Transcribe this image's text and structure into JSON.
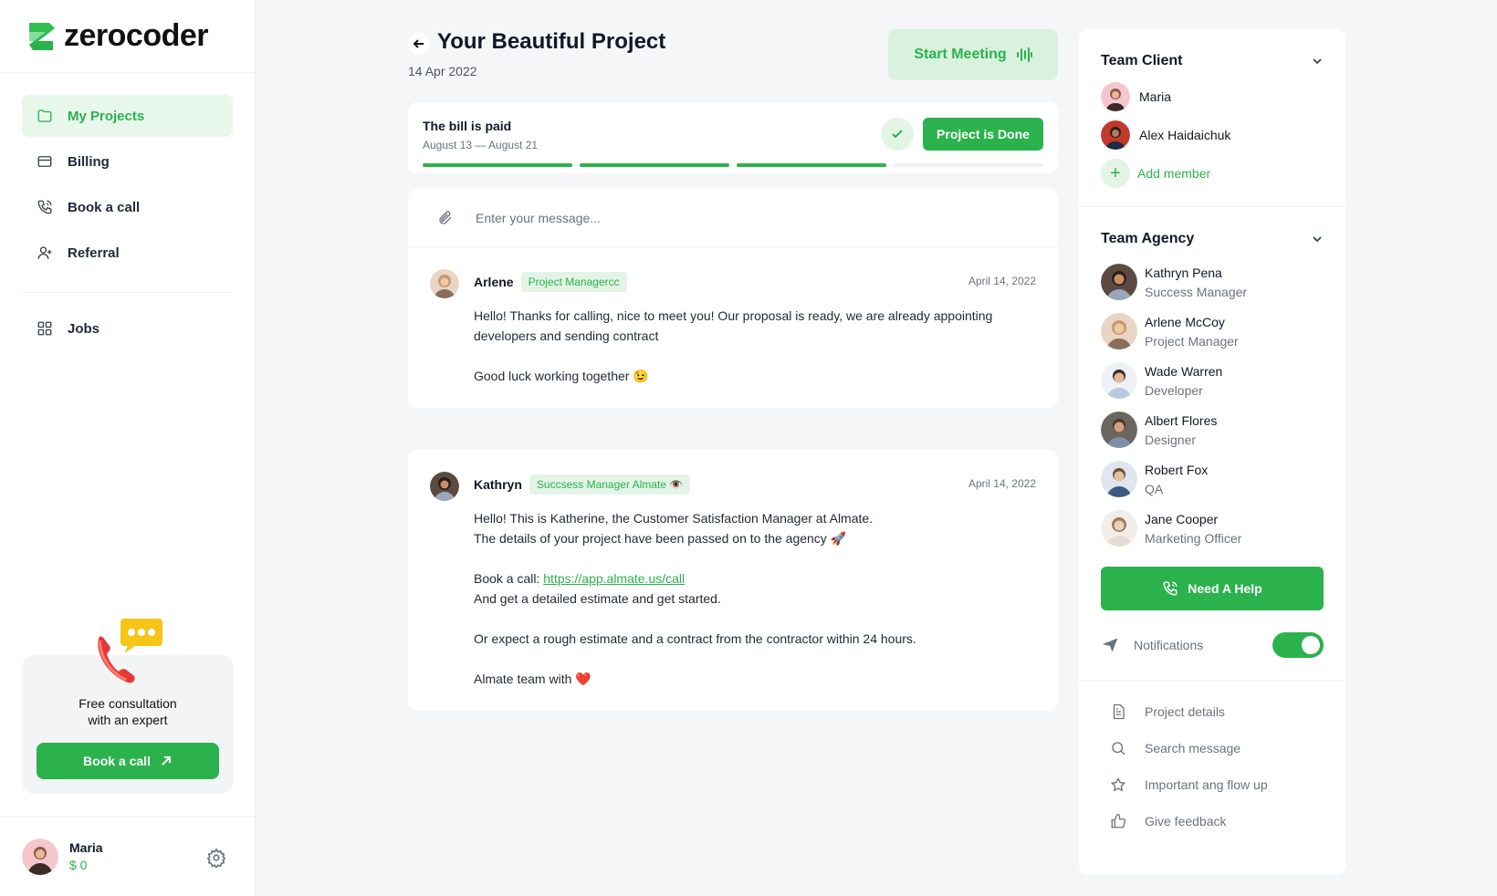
{
  "brand": {
    "name": "zerocoder",
    "accent": "#2bb24c"
  },
  "sidebar": {
    "items": [
      {
        "label": "My Projects",
        "icon": "folder-icon",
        "active": true
      },
      {
        "label": "Billing",
        "icon": "card-icon"
      },
      {
        "label": "Book a call",
        "icon": "phone-icon"
      },
      {
        "label": "Referral",
        "icon": "user-plus-icon"
      }
    ],
    "jobs": {
      "label": "Jobs",
      "icon": "grid-icon"
    },
    "promo": {
      "line1": "Free consultation",
      "line2": "with an expert",
      "button": "Book a call"
    },
    "user": {
      "name": "Maria",
      "balance": "$ 0"
    }
  },
  "project": {
    "title": "Your Beautiful Project",
    "date": "14 Apr 2022",
    "meeting_button": "Start Meeting",
    "bill": {
      "title": "The bill is paid",
      "range": "August 13 — August 21",
      "done_button": "Project is Done",
      "progress_steps_done": 3,
      "progress_steps_total": 4
    }
  },
  "composer": {
    "placeholder": "Enter your message..."
  },
  "messages": [
    {
      "author": "Arlene",
      "tag": "Project Managercc",
      "date": "April 14, 2022",
      "lines": [
        "Hello! Thanks for calling, nice to meet you! Our proposal is ready, we are already appointing developers and sending contract",
        "",
        "Good luck working together 😉"
      ]
    },
    {
      "author": "Kathryn",
      "tag": "Succsess Manager Almate 👁️",
      "date": "April 14, 2022",
      "line1": "Hello! This is Katherine, the Customer Satisfaction Manager at Almate.",
      "line2": "The details of your project have been passed on to the agency 🚀",
      "call_prefix": "Book a call: ",
      "call_link": "https://app.almate.us/call",
      "line3": "And get a detailed estimate and get started.",
      "line4": "Or expect a rough estimate and a contract from the contractor within 24 hours.",
      "line5": "Almate team with ❤️"
    }
  ],
  "team_client": {
    "title": "Team Client",
    "members": [
      "Maria",
      "Alex Haidaichuk"
    ],
    "add_label": "Add member"
  },
  "team_agency": {
    "title": "Team Agency",
    "members": [
      {
        "name": "Kathryn Pena",
        "role": "Success Manager"
      },
      {
        "name": "Arlene McCoy",
        "role": "Project Manager"
      },
      {
        "name": "Wade Warren",
        "role": "Developer"
      },
      {
        "name": "Albert Flores",
        "role": "Designer"
      },
      {
        "name": "Robert Fox",
        "role": "QA"
      },
      {
        "name": "Jane Cooper",
        "role": "Marketing Officer"
      }
    ]
  },
  "help_button": "Need A Help",
  "notifications": {
    "label": "Notifications",
    "enabled": true
  },
  "links": [
    "Project details",
    "Search message",
    "Important ang flow up",
    "Give feedback"
  ]
}
